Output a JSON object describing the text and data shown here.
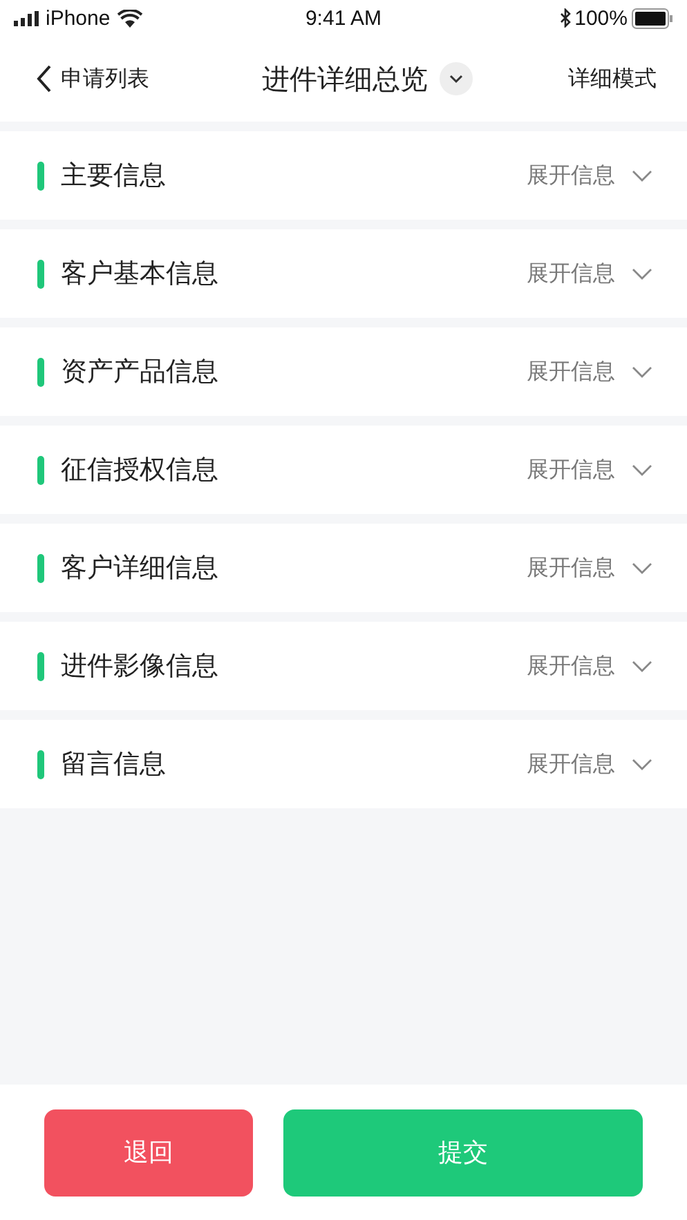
{
  "status_bar": {
    "carrier": "iPhone",
    "time": "9:41 AM",
    "battery": "100%"
  },
  "nav": {
    "back": "申请列表",
    "title": "进件详细总览",
    "action": "详细模式"
  },
  "sections": [
    {
      "title": "主要信息",
      "toggle": "展开信息"
    },
    {
      "title": "客户基本信息",
      "toggle": "展开信息"
    },
    {
      "title": "资产产品信息",
      "toggle": "展开信息"
    },
    {
      "title": "征信授权信息",
      "toggle": "展开信息"
    },
    {
      "title": "客户详细信息",
      "toggle": "展开信息"
    },
    {
      "title": "进件影像信息",
      "toggle": "展开信息"
    },
    {
      "title": "留言信息",
      "toggle": "展开信息"
    }
  ],
  "buttons": [
    {
      "label": "退回",
      "kind": "danger"
    },
    {
      "label": "提交",
      "kind": "primary"
    }
  ]
}
